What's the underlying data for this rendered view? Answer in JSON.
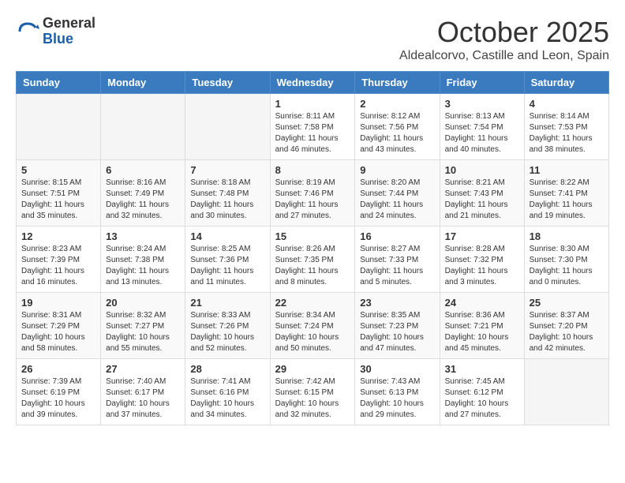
{
  "logo": {
    "general": "General",
    "blue": "Blue"
  },
  "header": {
    "month": "October 2025",
    "location": "Aldealcorvo, Castille and Leon, Spain"
  },
  "weekdays": [
    "Sunday",
    "Monday",
    "Tuesday",
    "Wednesday",
    "Thursday",
    "Friday",
    "Saturday"
  ],
  "weeks": [
    [
      {
        "day": "",
        "info": ""
      },
      {
        "day": "",
        "info": ""
      },
      {
        "day": "",
        "info": ""
      },
      {
        "day": "1",
        "info": "Sunrise: 8:11 AM\nSunset: 7:58 PM\nDaylight: 11 hours\nand 46 minutes."
      },
      {
        "day": "2",
        "info": "Sunrise: 8:12 AM\nSunset: 7:56 PM\nDaylight: 11 hours\nand 43 minutes."
      },
      {
        "day": "3",
        "info": "Sunrise: 8:13 AM\nSunset: 7:54 PM\nDaylight: 11 hours\nand 40 minutes."
      },
      {
        "day": "4",
        "info": "Sunrise: 8:14 AM\nSunset: 7:53 PM\nDaylight: 11 hours\nand 38 minutes."
      }
    ],
    [
      {
        "day": "5",
        "info": "Sunrise: 8:15 AM\nSunset: 7:51 PM\nDaylight: 11 hours\nand 35 minutes."
      },
      {
        "day": "6",
        "info": "Sunrise: 8:16 AM\nSunset: 7:49 PM\nDaylight: 11 hours\nand 32 minutes."
      },
      {
        "day": "7",
        "info": "Sunrise: 8:18 AM\nSunset: 7:48 PM\nDaylight: 11 hours\nand 30 minutes."
      },
      {
        "day": "8",
        "info": "Sunrise: 8:19 AM\nSunset: 7:46 PM\nDaylight: 11 hours\nand 27 minutes."
      },
      {
        "day": "9",
        "info": "Sunrise: 8:20 AM\nSunset: 7:44 PM\nDaylight: 11 hours\nand 24 minutes."
      },
      {
        "day": "10",
        "info": "Sunrise: 8:21 AM\nSunset: 7:43 PM\nDaylight: 11 hours\nand 21 minutes."
      },
      {
        "day": "11",
        "info": "Sunrise: 8:22 AM\nSunset: 7:41 PM\nDaylight: 11 hours\nand 19 minutes."
      }
    ],
    [
      {
        "day": "12",
        "info": "Sunrise: 8:23 AM\nSunset: 7:39 PM\nDaylight: 11 hours\nand 16 minutes."
      },
      {
        "day": "13",
        "info": "Sunrise: 8:24 AM\nSunset: 7:38 PM\nDaylight: 11 hours\nand 13 minutes."
      },
      {
        "day": "14",
        "info": "Sunrise: 8:25 AM\nSunset: 7:36 PM\nDaylight: 11 hours\nand 11 minutes."
      },
      {
        "day": "15",
        "info": "Sunrise: 8:26 AM\nSunset: 7:35 PM\nDaylight: 11 hours\nand 8 minutes."
      },
      {
        "day": "16",
        "info": "Sunrise: 8:27 AM\nSunset: 7:33 PM\nDaylight: 11 hours\nand 5 minutes."
      },
      {
        "day": "17",
        "info": "Sunrise: 8:28 AM\nSunset: 7:32 PM\nDaylight: 11 hours\nand 3 minutes."
      },
      {
        "day": "18",
        "info": "Sunrise: 8:30 AM\nSunset: 7:30 PM\nDaylight: 11 hours\nand 0 minutes."
      }
    ],
    [
      {
        "day": "19",
        "info": "Sunrise: 8:31 AM\nSunset: 7:29 PM\nDaylight: 10 hours\nand 58 minutes."
      },
      {
        "day": "20",
        "info": "Sunrise: 8:32 AM\nSunset: 7:27 PM\nDaylight: 10 hours\nand 55 minutes."
      },
      {
        "day": "21",
        "info": "Sunrise: 8:33 AM\nSunset: 7:26 PM\nDaylight: 10 hours\nand 52 minutes."
      },
      {
        "day": "22",
        "info": "Sunrise: 8:34 AM\nSunset: 7:24 PM\nDaylight: 10 hours\nand 50 minutes."
      },
      {
        "day": "23",
        "info": "Sunrise: 8:35 AM\nSunset: 7:23 PM\nDaylight: 10 hours\nand 47 minutes."
      },
      {
        "day": "24",
        "info": "Sunrise: 8:36 AM\nSunset: 7:21 PM\nDaylight: 10 hours\nand 45 minutes."
      },
      {
        "day": "25",
        "info": "Sunrise: 8:37 AM\nSunset: 7:20 PM\nDaylight: 10 hours\nand 42 minutes."
      }
    ],
    [
      {
        "day": "26",
        "info": "Sunrise: 7:39 AM\nSunset: 6:19 PM\nDaylight: 10 hours\nand 39 minutes."
      },
      {
        "day": "27",
        "info": "Sunrise: 7:40 AM\nSunset: 6:17 PM\nDaylight: 10 hours\nand 37 minutes."
      },
      {
        "day": "28",
        "info": "Sunrise: 7:41 AM\nSunset: 6:16 PM\nDaylight: 10 hours\nand 34 minutes."
      },
      {
        "day": "29",
        "info": "Sunrise: 7:42 AM\nSunset: 6:15 PM\nDaylight: 10 hours\nand 32 minutes."
      },
      {
        "day": "30",
        "info": "Sunrise: 7:43 AM\nSunset: 6:13 PM\nDaylight: 10 hours\nand 29 minutes."
      },
      {
        "day": "31",
        "info": "Sunrise: 7:45 AM\nSunset: 6:12 PM\nDaylight: 10 hours\nand 27 minutes."
      },
      {
        "day": "",
        "info": ""
      }
    ]
  ]
}
